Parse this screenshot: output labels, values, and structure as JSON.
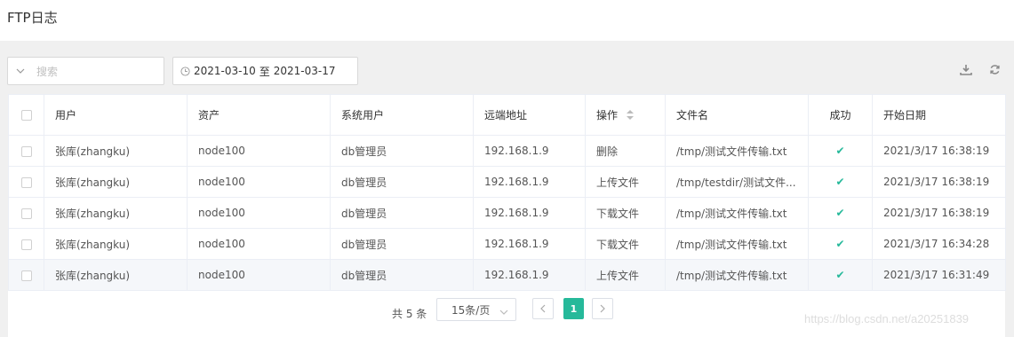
{
  "page": {
    "title": "FTP日志"
  },
  "search": {
    "placeholder": "搜索"
  },
  "date_range": {
    "start": "2021-03-10",
    "separator": "至",
    "end": "2021-03-17"
  },
  "toolbar": {
    "download_icon": "download-icon",
    "refresh_icon": "refresh-icon"
  },
  "table": {
    "columns": [
      "用户",
      "资产",
      "系统用户",
      "远端地址",
      "操作",
      "文件名",
      "成功",
      "开始日期"
    ],
    "rows": [
      {
        "user": "张库(zhangku)",
        "asset": "node100",
        "system_user": "db管理员",
        "remote_addr": "192.168.1.9",
        "operation": "删除",
        "filename": "/tmp/测试文件传输.txt",
        "success": "✔",
        "start_date": "2021/3/17 16:38:19"
      },
      {
        "user": "张库(zhangku)",
        "asset": "node100",
        "system_user": "db管理员",
        "remote_addr": "192.168.1.9",
        "operation": "上传文件",
        "filename": "/tmp/testdir/测试文件...",
        "success": "✔",
        "start_date": "2021/3/17 16:38:19"
      },
      {
        "user": "张库(zhangku)",
        "asset": "node100",
        "system_user": "db管理员",
        "remote_addr": "192.168.1.9",
        "operation": "下载文件",
        "filename": "/tmp/测试文件传输.txt",
        "success": "✔",
        "start_date": "2021/3/17 16:38:19"
      },
      {
        "user": "张库(zhangku)",
        "asset": "node100",
        "system_user": "db管理员",
        "remote_addr": "192.168.1.9",
        "operation": "下载文件",
        "filename": "/tmp/测试文件传输.txt",
        "success": "✔",
        "start_date": "2021/3/17 16:34:28"
      },
      {
        "user": "张库(zhangku)",
        "asset": "node100",
        "system_user": "db管理员",
        "remote_addr": "192.168.1.9",
        "operation": "上传文件",
        "filename": "/tmp/测试文件传输.txt",
        "success": "✔",
        "start_date": "2021/3/17 16:31:49"
      }
    ]
  },
  "pagination": {
    "total": "共 5 条",
    "page_size": "15条/页",
    "current_page": "1"
  },
  "watermark": "https://blog.csdn.net/a20251839",
  "colors": {
    "accent": "#26b99a"
  }
}
